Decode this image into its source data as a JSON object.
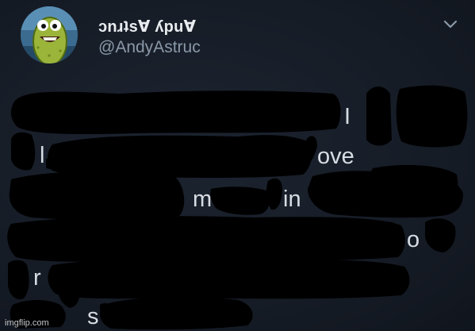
{
  "tweet": {
    "display_name": "ɔnɹʇsⱯ ʎpuⱯ",
    "handle": "@AndyAstruc",
    "visible_fragments": {
      "line1": "I",
      "line2_a": "l",
      "line2_b": "ove",
      "line3_a": "m",
      "line3_b": "in",
      "line4": "o",
      "line5": "r",
      "line6": "s"
    }
  },
  "icons": {
    "avatar": "cartoon-pickle-avatar",
    "menu": "chevron-down-icon"
  },
  "watermark": "imgflip.com",
  "colors": {
    "background": "#161c26",
    "text": "#d8dde3",
    "handle": "#8a98a8",
    "redaction": "#000000"
  }
}
